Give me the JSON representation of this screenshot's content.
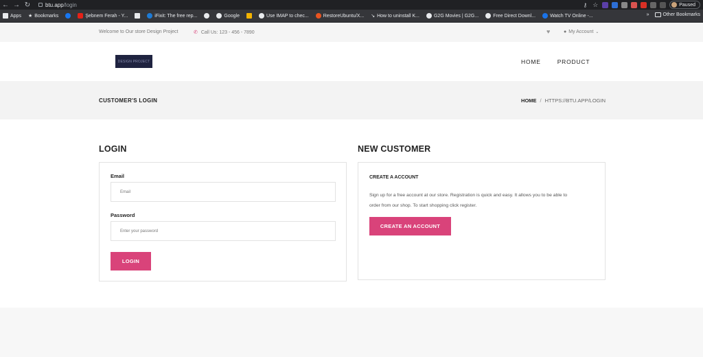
{
  "browser": {
    "url_host": "btu.app",
    "url_path": "/login",
    "paused_label": "Paused",
    "bookmarks": [
      {
        "label": "Apps",
        "icon": "apps-grid-icon"
      },
      {
        "label": "Bookmarks",
        "icon": "star-icon"
      },
      {
        "label": "",
        "icon": "facebook-icon"
      },
      {
        "label": "Şebnem Ferah - Y...",
        "icon": "youtube-icon"
      },
      {
        "label": "",
        "icon": "bookmark-icon"
      },
      {
        "label": "iFixit: The free rep...",
        "icon": "ifixit-icon"
      },
      {
        "label": "",
        "icon": "globe-icon"
      },
      {
        "label": "Google",
        "icon": "google-icon"
      },
      {
        "label": "",
        "icon": "bookmark-icon"
      },
      {
        "label": "Use IMAP to chec...",
        "icon": "google-icon"
      },
      {
        "label": "RestoreUbuntu/X...",
        "icon": "ubuntu-icon"
      },
      {
        "label": "How to uninstall K...",
        "icon": "tool-icon"
      },
      {
        "label": "G2G Movies | G2G...",
        "icon": "globe-icon"
      },
      {
        "label": "Free Direct Downl...",
        "icon": "globe-icon"
      },
      {
        "label": "Watch TV Online -...",
        "icon": "globe-icon"
      }
    ],
    "other_bookmarks": "Other Bookmarks"
  },
  "topbar": {
    "welcome": "Welcome to Our store Design Project",
    "call": "Call Us: 123 - 456 - 7890",
    "account": "My Account"
  },
  "header": {
    "logo_text": "DESIGN PROJECT",
    "menu": [
      "HOME",
      "PRODUCT"
    ]
  },
  "titlebar": {
    "title": "CUSTOMER'S LOGIN",
    "crumb_home": "HOME",
    "crumb_sep": "/",
    "crumb_current": "HTTPS://BTU.APP/LOGIN"
  },
  "login": {
    "heading": "LOGIN",
    "email_label": "Email",
    "email_placeholder": "Email",
    "password_label": "Password",
    "password_placeholder": "Enter your password",
    "button": "LOGIN"
  },
  "new_customer": {
    "heading": "NEW CUSTOMER",
    "subheading": "CREATE A ACCOUNT",
    "description_line1": "Sign up for a free account at our store. Registration is quick and easy. It allows you to be able to",
    "description_line2": "order from our shop. To start shopping click register.",
    "button": "CREATE AN ACCOUNT"
  },
  "colors": {
    "accent": "#d9437a",
    "logo_bg": "#1f2340"
  }
}
